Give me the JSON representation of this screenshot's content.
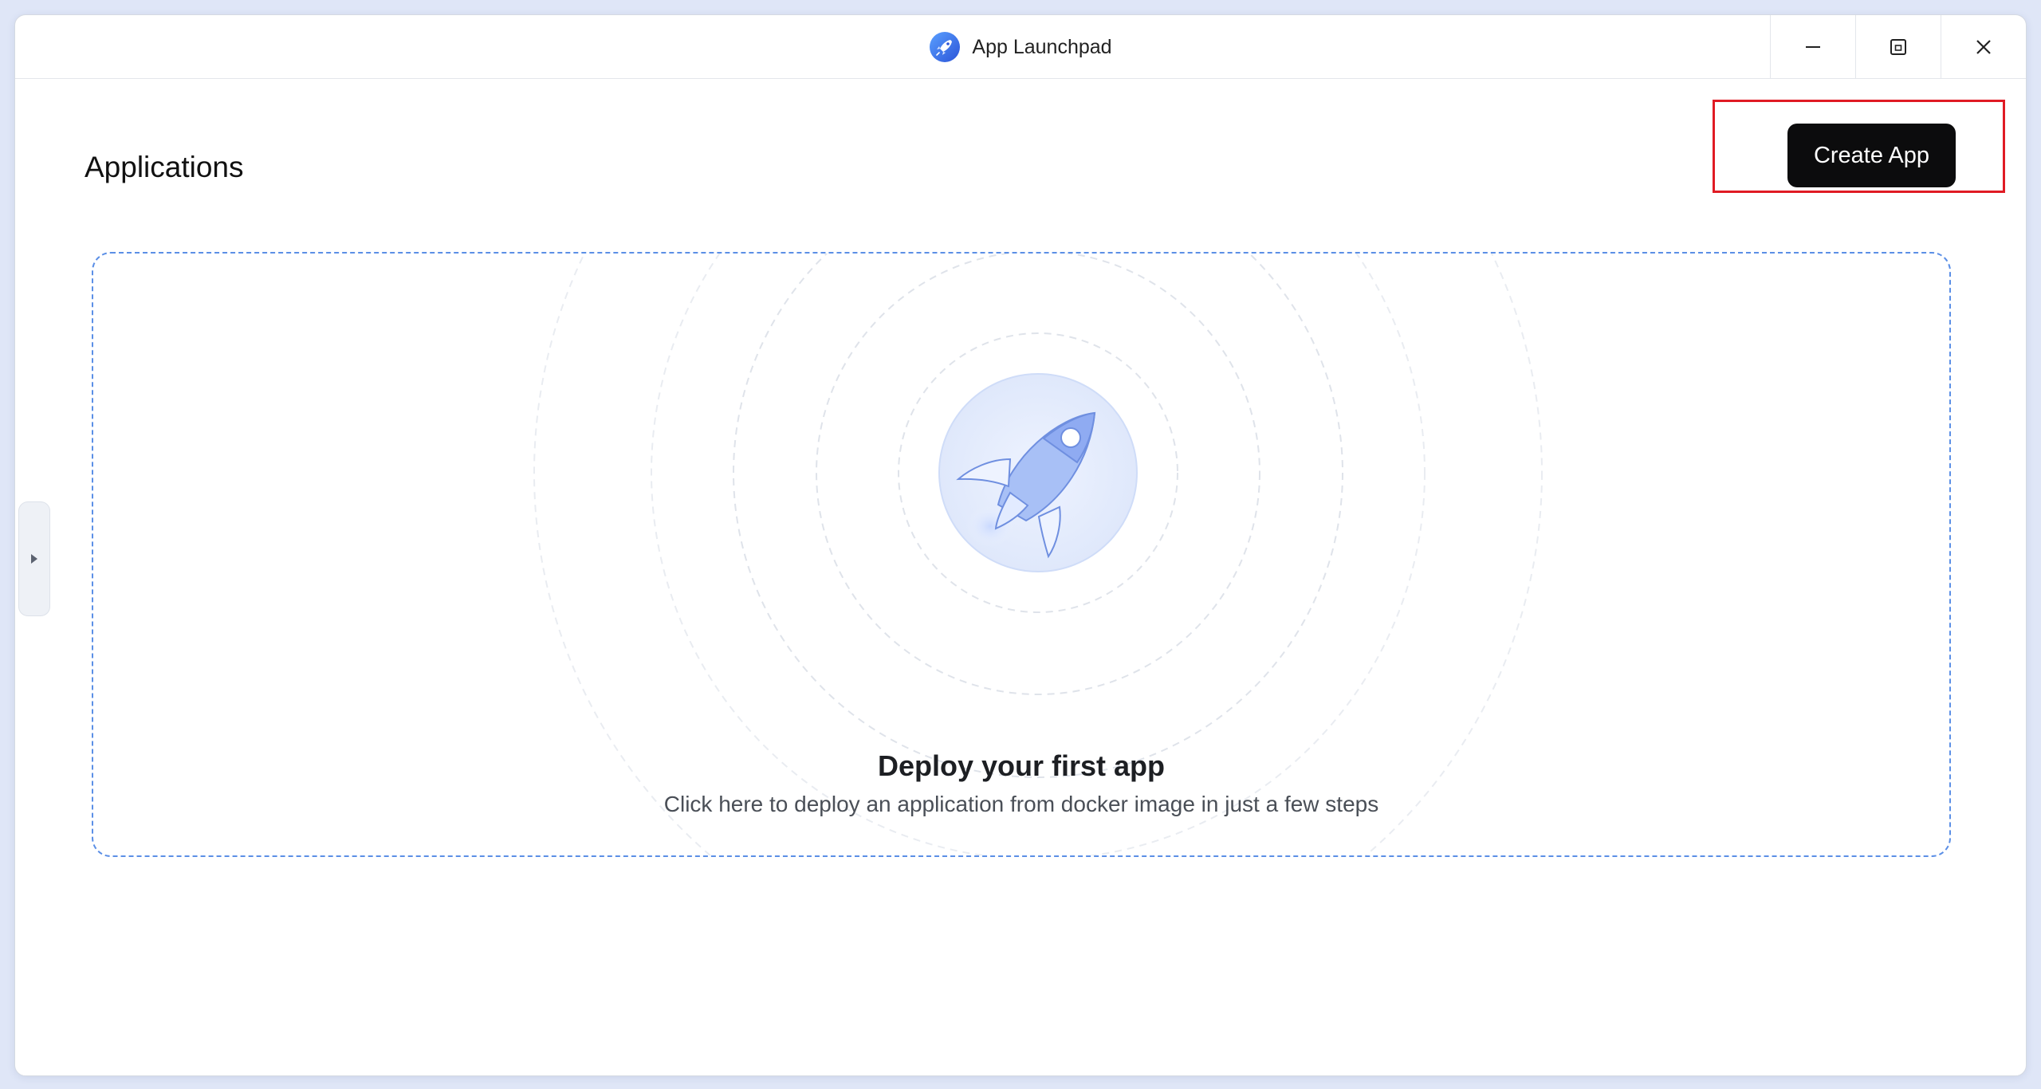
{
  "window": {
    "title": "App Launchpad",
    "app_icon": "rocket-icon",
    "controls": {
      "minimize_icon": "minimize-icon",
      "restore_icon": "restore-icon",
      "close_icon": "close-icon"
    }
  },
  "header": {
    "page_title": "Applications",
    "create_button": "Create App"
  },
  "empty_state": {
    "title": "Deploy your first app",
    "subtitle": "Click here to deploy an application from docker image in just a few steps",
    "illustration_icon": "rocket-icon"
  },
  "sidebar_toggle": {
    "icon": "caret-right-icon"
  },
  "colors": {
    "accent_blue": "#5b8fe6",
    "button_bg": "#0c0c0d",
    "highlight_red": "#e01b24",
    "desktop_bg": "#dfe6f7"
  }
}
